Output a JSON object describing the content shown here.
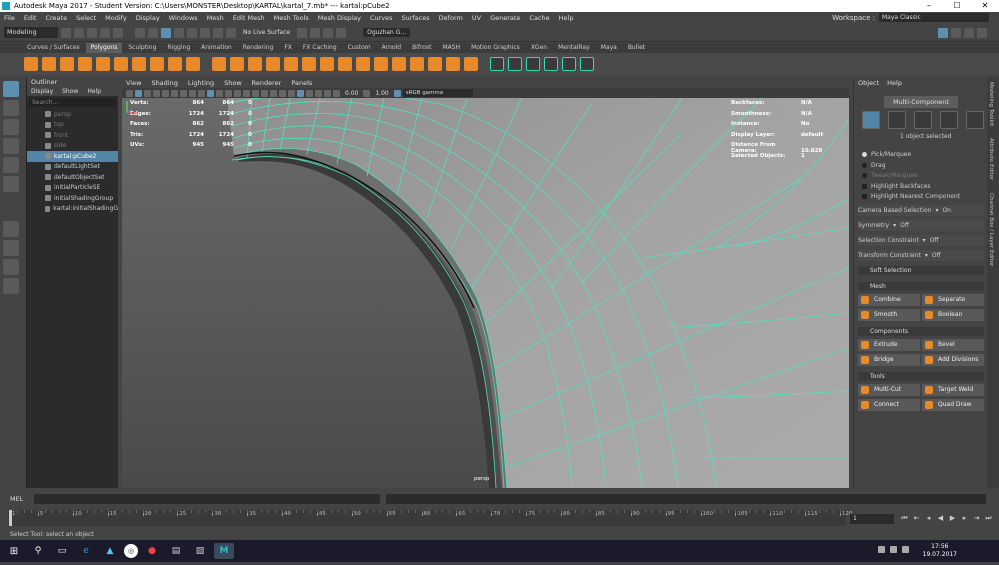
{
  "window": {
    "title": "Autodesk Maya 2017 - Student Version: C:\\Users\\MONSTER\\Desktop\\KARTAL\\kartal_7.mb*  ---  kartal:pCube2"
  },
  "menus": [
    "File",
    "Edit",
    "Create",
    "Select",
    "Modify",
    "Display",
    "Windows",
    "Mesh",
    "Edit Mesh",
    "Mesh Tools",
    "Mesh Display",
    "Curves",
    "Surfaces",
    "Deform",
    "UV",
    "Generate",
    "Cache",
    "Help"
  ],
  "workspace": {
    "label": "Workspace :",
    "value": "Maya Classic"
  },
  "statusline": {
    "mode": "Modeling",
    "live_surface": "No Live Surface",
    "user": "Oguzhan G..."
  },
  "shelf_tabs": [
    "Curves / Surfaces",
    "Polygons",
    "Sculpting",
    "Rigging",
    "Animation",
    "Rendering",
    "FX",
    "FX Caching",
    "Custom",
    "Arnold",
    "Bifrost",
    "MASH",
    "Motion Graphics",
    "XGen",
    "MentalRay",
    "Maya",
    "Bullet"
  ],
  "shelf_active": "Polygons",
  "outliner": {
    "title": "Outliner",
    "menu": [
      "Display",
      "Show",
      "Help"
    ],
    "search_placeholder": "Search...",
    "items": [
      {
        "label": "persp",
        "state": "dim"
      },
      {
        "label": "top",
        "state": "dim"
      },
      {
        "label": "front",
        "state": "dim"
      },
      {
        "label": "side",
        "state": "dim"
      },
      {
        "label": "kartal:pCube2",
        "state": "sel"
      },
      {
        "label": "defaultLightSet",
        "state": "normal"
      },
      {
        "label": "defaultObjectSet",
        "state": "normal"
      },
      {
        "label": "initialParticleSE",
        "state": "normal"
      },
      {
        "label": "initialShadingGroup",
        "state": "normal"
      },
      {
        "label": "kartal:initialShadingG",
        "state": "normal"
      }
    ]
  },
  "viewport": {
    "menu": [
      "View",
      "Shading",
      "Lighting",
      "Show",
      "Renderer",
      "Panels"
    ],
    "toolbar": {
      "val1": "0.00",
      "val2": "1.00",
      "gamma": "sRGB gamma"
    },
    "hud_left": [
      {
        "label": "Verts:",
        "v1": "864",
        "v2": "864",
        "v3": "0"
      },
      {
        "label": "Edges:",
        "v1": "1724",
        "v2": "1724",
        "v3": "0"
      },
      {
        "label": "Faces:",
        "v1": "862",
        "v2": "862",
        "v3": "0"
      },
      {
        "label": "Tris:",
        "v1": "1724",
        "v2": "1724",
        "v3": "0"
      },
      {
        "label": "UVs:",
        "v1": "945",
        "v2": "945",
        "v3": "0"
      }
    ],
    "hud_right": [
      {
        "label": "Backfaces:",
        "value": "N/A"
      },
      {
        "label": "Smoothness:",
        "value": "N/A"
      },
      {
        "label": "Instance:",
        "value": "No"
      },
      {
        "label": "Display Layer:",
        "value": "default"
      },
      {
        "label": "Distance From Camera:",
        "value": "10.828"
      },
      {
        "label": "Selected Objects:",
        "value": "1"
      }
    ],
    "camera": "persp"
  },
  "modeling_toolkit": {
    "menu": [
      "Object",
      "Help"
    ],
    "mode_button": "Multi-Component",
    "selection_status": "1 object selected",
    "options": [
      {
        "label": "Pick/Marquee",
        "kind": "radio",
        "on": true,
        "dim": false
      },
      {
        "label": "Drag",
        "kind": "radio",
        "on": false,
        "dim": false
      },
      {
        "label": "Tweak/Marquee",
        "kind": "radio",
        "on": false,
        "dim": true
      },
      {
        "label": "Highlight Backfaces",
        "kind": "check",
        "on": false,
        "dim": false
      },
      {
        "label": "Highlight Nearest Component",
        "kind": "check",
        "on": false,
        "dim": false
      }
    ],
    "settings": [
      {
        "label": "Camera Based Selection",
        "value": "On"
      },
      {
        "label": "Symmetry",
        "value": "Off"
      },
      {
        "label": "Selection Constraint",
        "value": "Off"
      },
      {
        "label": "Transform Constraint",
        "value": "Off"
      }
    ],
    "soft_selection": "Soft Selection",
    "sections": [
      {
        "title": "Mesh",
        "buttons": [
          "Combine",
          "Separate",
          "Smooth",
          "Boolean"
        ]
      },
      {
        "title": "Components",
        "buttons": [
          "Extrude",
          "Bevel",
          "Bridge",
          "Add Divisions"
        ]
      },
      {
        "title": "Tools",
        "buttons": [
          "Multi-Cut",
          "Target Weld",
          "Connect",
          "Quad Draw"
        ]
      }
    ]
  },
  "side_tabs": [
    "Modeling Toolkit",
    "Attribute Editor",
    "Channel Box / Layer Editor"
  ],
  "command_line": {
    "label": "MEL"
  },
  "timeline": {
    "ticks": [
      "1",
      "5",
      "10",
      "15",
      "20",
      "25",
      "30",
      "35",
      "40",
      "45",
      "50",
      "55",
      "60",
      "65",
      "70",
      "75",
      "80",
      "85",
      "90",
      "95",
      "100",
      "105",
      "110",
      "115",
      "120"
    ],
    "current_frame": "1"
  },
  "help_line": "Select Tool: select an object",
  "taskbar": {
    "time": "17:56",
    "date": "19.07.2017"
  },
  "colors": {
    "wire": "#55e0b8",
    "selected": "#5285a6",
    "accent_orange": "#e88a2a"
  }
}
